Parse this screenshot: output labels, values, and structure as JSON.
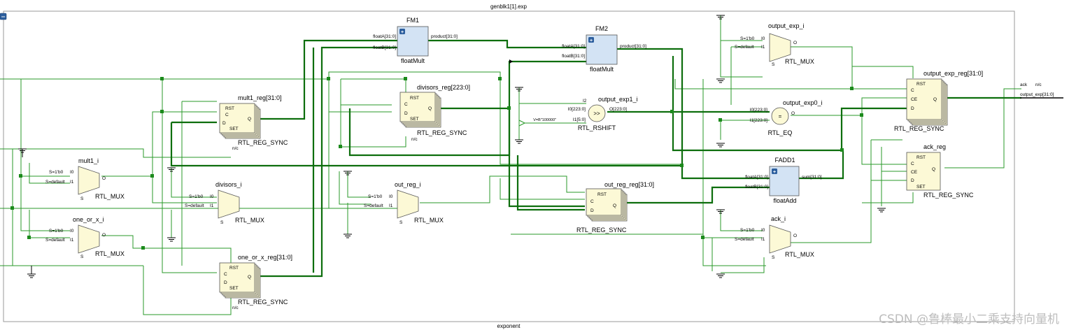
{
  "hierarchy": {
    "title": "genblk1[1].exp",
    "bottom_label": "exponent",
    "collapse_symbol": "−"
  },
  "ports": {
    "ack": "ack",
    "ack_nc": "n/c",
    "output_exp": "output_exp[31:0]"
  },
  "muxes": [
    {
      "name": "mult1_i",
      "type": "RTL_MUX",
      "sel0": "S=1'b0",
      "sel1": "S=default",
      "in0": "I0",
      "in1": "I1",
      "s": "S",
      "out": "O"
    },
    {
      "name": "one_or_x_i",
      "type": "RTL_MUX",
      "sel0": "S=1'b0",
      "sel1": "S=default",
      "in0": "I0",
      "in1": "I1",
      "s": "S",
      "out": "O"
    },
    {
      "name": "divisors_i",
      "type": "RTL_MUX",
      "sel0": "S=1'b0",
      "sel1": "S=default",
      "in0": "I0",
      "in1": "I1",
      "s": "S",
      "out": "O"
    },
    {
      "name": "out_reg_i",
      "type": "RTL_MUX",
      "sel0": "S=1'b0",
      "sel1": "S=default",
      "in0": "I0",
      "in1": "I1",
      "s": "S",
      "out": "O"
    },
    {
      "name": "output_exp_i",
      "type": "RTL_MUX",
      "sel0": "S=1'b0",
      "sel1": "S=default",
      "in0": "I0",
      "in1": "I1",
      "s": "S",
      "out": "O"
    },
    {
      "name": "ack_i",
      "type": "RTL_MUX",
      "sel0": "S=1'b0",
      "sel1": "S=default",
      "in0": "I0",
      "in1": "I1",
      "s": "S",
      "out": "O"
    }
  ],
  "registers": [
    {
      "name": "mult1_reg[31:0]",
      "type": "RTL_REG_SYNC",
      "rst": "RST",
      "c": "C",
      "d": "D",
      "set": "SET",
      "q": "Q",
      "nc": "n/c"
    },
    {
      "name": "divisors_reg[223:0]",
      "type": "RTL_REG_SYNC",
      "rst": "RST",
      "c": "C",
      "d": "D",
      "set": "SET",
      "q": "Q",
      "nc": "n/c"
    },
    {
      "name": "one_or_x_reg[31:0]",
      "type": "RTL_REG_SYNC",
      "rst": "RST",
      "c": "C",
      "d": "D",
      "set": "SET",
      "q": "Q",
      "nc": "n/c"
    },
    {
      "name": "out_reg_reg[31:0]",
      "type": "RTL_REG_SYNC",
      "rst": "RST",
      "c": "C",
      "d": "D",
      "q": "Q"
    },
    {
      "name": "output_exp_reg[31:0]",
      "type": "RTL_REG_SYNC",
      "rst": "RST",
      "c": "C",
      "ce": "CE",
      "d": "D",
      "q": "Q"
    },
    {
      "name": "ack_reg",
      "type": "RTL_REG_SYNC",
      "rst": "RST",
      "c": "C",
      "ce": "CE",
      "d": "D",
      "set": "SET",
      "q": "Q"
    }
  ],
  "ip_blocks": [
    {
      "name": "FM1",
      "module": "floatMult",
      "a": "floatA[31:0]",
      "b": "floatB[31:0]",
      "out": "product[31:0]",
      "mark": "+"
    },
    {
      "name": "FM2",
      "module": "floatMult",
      "a": "floatA[31:0]",
      "b": "floatB[31:0]",
      "out": "product[31:0]",
      "mark": "+"
    },
    {
      "name": "FADD1",
      "module": "floatAdd",
      "a": "floatA[31:0]",
      "b": "floatB[31:0]",
      "out": "sum[31:0]",
      "mark": "+"
    }
  ],
  "ops": {
    "rshift": {
      "name": "output_exp1_i",
      "type": "RTL_RSHIFT",
      "symbol": ">>",
      "i2": "I2",
      "i0": "I0[223:0]",
      "i1": "I1[5:0]",
      "out": "O[223:0]",
      "const": "V=B\"100000\""
    },
    "eq": {
      "name": "output_exp0_i",
      "type": "RTL_EQ",
      "symbol": "=",
      "i0": "I0[223:0]",
      "i1": "I1[223:0]",
      "out": "O"
    }
  },
  "watermark": "CSDN @鲁棒最小二乘支持向量机",
  "colors": {
    "wire": "#2a9a2a",
    "bus": "#0d6e0d",
    "block_fill": "#fcf9d6",
    "ip_fill": "#d3e3f4",
    "frame": "#9a9a9a"
  }
}
